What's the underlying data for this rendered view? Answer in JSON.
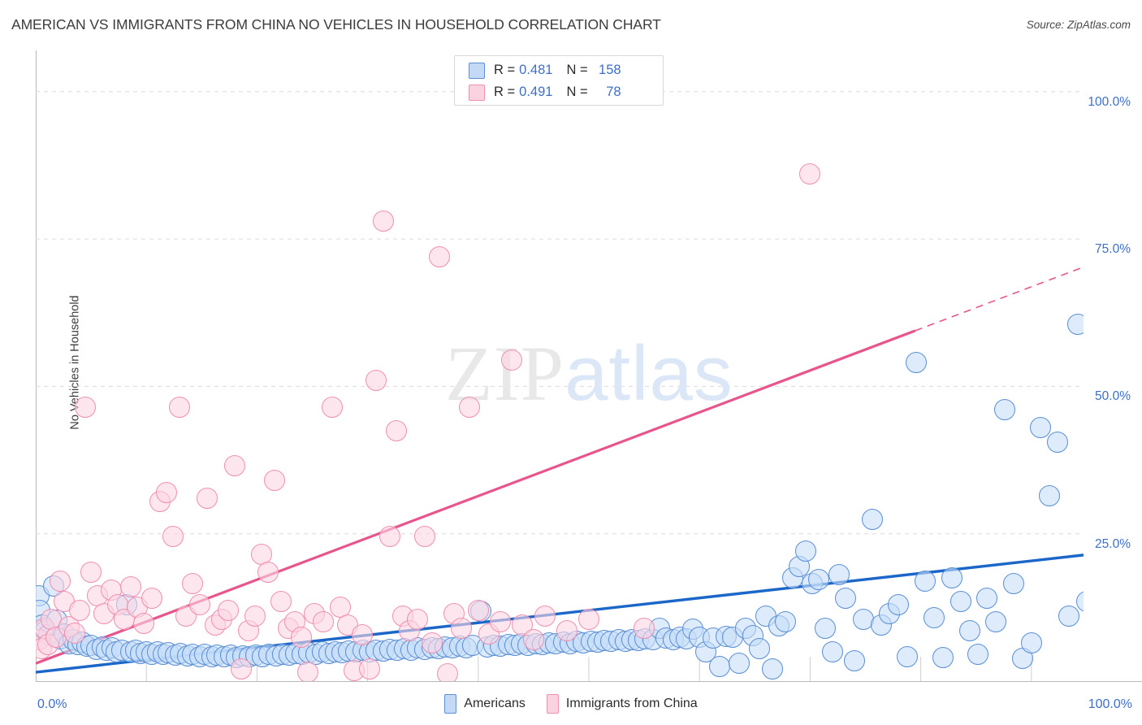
{
  "header": {
    "title": "AMERICAN VS IMMIGRANTS FROM CHINA NO VEHICLES IN HOUSEHOLD CORRELATION CHART",
    "source": "Source: ZipAtlas.com"
  },
  "watermark": {
    "part1": "ZIP",
    "part2": "atlas"
  },
  "stats_legend": {
    "rows": [
      {
        "series": "Americans",
        "r_label": "R = ",
        "r_value": "0.481",
        "n_label": "N = ",
        "n_value": "158",
        "color": "#c3d9f6"
      },
      {
        "series": "Immigrants from China",
        "r_label": "R = ",
        "r_value": "0.491",
        "n_label": "N = ",
        "n_value": "78",
        "color": "#fbd3e0"
      }
    ]
  },
  "series_legend": [
    {
      "label": "Americans",
      "color": "#c3d9f6"
    },
    {
      "label": "Immigrants from China",
      "color": "#fbd3e0"
    }
  ],
  "axes": {
    "y_title": "No Vehicles in Household",
    "y_ticks": [
      "100.0%",
      "75.0%",
      "50.0%",
      "25.0%"
    ],
    "x_min_label": "0.0%",
    "x_max_label": "100.0%"
  },
  "colors": {
    "blue_line": "#1b66c9",
    "pink_line": "#e8548c",
    "blue_fill": "#c6def8",
    "blue_stroke": "#5b8fd4",
    "pink_fill": "#fbd5e2",
    "pink_stroke": "#ef8fb0",
    "tick_text": "#3d6fc4",
    "grid": "#dcdcdc"
  },
  "chart_data": {
    "type": "scatter",
    "title": "AMERICAN VS IMMIGRANTS FROM CHINA NO VEHICLES IN HOUSEHOLD CORRELATION CHART",
    "xlabel": "",
    "ylabel": "No Vehicles in Household",
    "xlim": [
      0,
      100
    ],
    "ylim": [
      0,
      107
    ],
    "x_ticks": [
      0,
      100
    ],
    "y_ticks": [
      25,
      50,
      75,
      100
    ],
    "grid": true,
    "legend_position": "bottom-center",
    "series": [
      {
        "name": "Americans",
        "color": "#c6def8",
        "stroke": "#5b8fd4",
        "R": 0.481,
        "N": 158,
        "trend": {
          "x0": 0,
          "y0": 1.5,
          "x1": 100,
          "y1": 22.5,
          "color": "#1b66c9",
          "style": "solid"
        },
        "points": [
          [
            0.3,
            14.5
          ],
          [
            0.4,
            12.0
          ],
          [
            0.6,
            9.5
          ],
          [
            0.9,
            8.6
          ],
          [
            1.2,
            7.8
          ],
          [
            1.6,
            16.2
          ],
          [
            1.9,
            10.4
          ],
          [
            2.2,
            7.2
          ],
          [
            2.6,
            8.0
          ],
          [
            3.0,
            6.4
          ],
          [
            3.4,
            7.0
          ],
          [
            3.8,
            6.2
          ],
          [
            4.2,
            6.6
          ],
          [
            4.6,
            5.9
          ],
          [
            5.0,
            6.1
          ],
          [
            5.5,
            5.4
          ],
          [
            6.0,
            5.8
          ],
          [
            6.4,
            5.2
          ],
          [
            6.9,
            5.6
          ],
          [
            7.3,
            5.0
          ],
          [
            7.8,
            5.3
          ],
          [
            8.2,
            13.0
          ],
          [
            8.6,
            4.9
          ],
          [
            9.0,
            5.2
          ],
          [
            9.5,
            4.7
          ],
          [
            10.0,
            5.0
          ],
          [
            10.5,
            4.6
          ],
          [
            11.0,
            4.9
          ],
          [
            11.5,
            4.5
          ],
          [
            12.0,
            4.8
          ],
          [
            12.6,
            4.4
          ],
          [
            13.1,
            4.7
          ],
          [
            13.7,
            4.3
          ],
          [
            14.2,
            4.6
          ],
          [
            14.8,
            4.2
          ],
          [
            15.3,
            4.5
          ],
          [
            15.9,
            4.2
          ],
          [
            16.4,
            4.4
          ],
          [
            17.0,
            4.1
          ],
          [
            17.6,
            4.4
          ],
          [
            18.1,
            4.0
          ],
          [
            18.7,
            4.3
          ],
          [
            19.3,
            4.1
          ],
          [
            19.9,
            4.4
          ],
          [
            20.5,
            4.2
          ],
          [
            21.1,
            4.5
          ],
          [
            21.7,
            4.3
          ],
          [
            22.3,
            4.6
          ],
          [
            22.9,
            4.4
          ],
          [
            23.5,
            4.7
          ],
          [
            24.1,
            4.5
          ],
          [
            24.7,
            4.8
          ],
          [
            25.3,
            4.6
          ],
          [
            25.9,
            4.9
          ],
          [
            26.5,
            4.7
          ],
          [
            27.1,
            5.0
          ],
          [
            27.7,
            4.8
          ],
          [
            28.3,
            5.1
          ],
          [
            28.9,
            4.9
          ],
          [
            29.6,
            5.2
          ],
          [
            30.2,
            5.0
          ],
          [
            30.8,
            5.3
          ],
          [
            31.4,
            5.1
          ],
          [
            32.0,
            5.4
          ],
          [
            32.7,
            5.2
          ],
          [
            33.3,
            5.5
          ],
          [
            33.9,
            5.3
          ],
          [
            34.5,
            5.6
          ],
          [
            35.2,
            5.4
          ],
          [
            35.8,
            5.7
          ],
          [
            36.4,
            5.5
          ],
          [
            37.0,
            5.8
          ],
          [
            37.7,
            5.6
          ],
          [
            38.3,
            5.9
          ],
          [
            38.9,
            5.7
          ],
          [
            39.5,
            6.0
          ],
          [
            40.2,
            11.8
          ],
          [
            40.8,
            5.8
          ],
          [
            41.4,
            6.1
          ],
          [
            42.0,
            5.9
          ],
          [
            42.7,
            6.2
          ],
          [
            43.3,
            6.0
          ],
          [
            43.9,
            6.3
          ],
          [
            44.5,
            6.1
          ],
          [
            45.2,
            6.4
          ],
          [
            45.8,
            6.2
          ],
          [
            46.4,
            6.5
          ],
          [
            47.0,
            6.3
          ],
          [
            47.7,
            6.6
          ],
          [
            48.3,
            6.4
          ],
          [
            48.9,
            6.7
          ],
          [
            49.5,
            6.5
          ],
          [
            50.2,
            6.8
          ],
          [
            50.8,
            6.6
          ],
          [
            51.4,
            6.9
          ],
          [
            52.0,
            6.7
          ],
          [
            52.7,
            7.0
          ],
          [
            53.3,
            6.8
          ],
          [
            53.9,
            7.1
          ],
          [
            54.5,
            6.9
          ],
          [
            55.1,
            7.2
          ],
          [
            55.8,
            7.0
          ],
          [
            56.4,
            9.0
          ],
          [
            57.0,
            7.3
          ],
          [
            57.6,
            7.1
          ],
          [
            58.2,
            7.4
          ],
          [
            58.8,
            7.2
          ],
          [
            59.4,
            8.8
          ],
          [
            60.0,
            7.5
          ],
          [
            60.6,
            5.0
          ],
          [
            61.2,
            7.3
          ],
          [
            61.8,
            2.5
          ],
          [
            62.4,
            7.6
          ],
          [
            63.0,
            7.4
          ],
          [
            63.6,
            3.0
          ],
          [
            64.2,
            8.9
          ],
          [
            64.8,
            7.7
          ],
          [
            65.4,
            5.5
          ],
          [
            66.0,
            11.0
          ],
          [
            66.6,
            2.0
          ],
          [
            67.2,
            9.4
          ],
          [
            67.8,
            10.0
          ],
          [
            68.4,
            17.5
          ],
          [
            69.0,
            19.5
          ],
          [
            69.6,
            22.0
          ],
          [
            70.2,
            16.5
          ],
          [
            70.8,
            17.2
          ],
          [
            71.4,
            9.0
          ],
          [
            72.0,
            5.0
          ],
          [
            72.6,
            18.0
          ],
          [
            73.2,
            14.0
          ],
          [
            74.0,
            3.5
          ],
          [
            74.8,
            10.5
          ],
          [
            75.6,
            27.5
          ],
          [
            76.4,
            9.5
          ],
          [
            77.2,
            11.5
          ],
          [
            78.0,
            13.0
          ],
          [
            78.8,
            4.2
          ],
          [
            79.6,
            54.0
          ],
          [
            80.4,
            17.0
          ],
          [
            81.2,
            10.8
          ],
          [
            82.0,
            4.0
          ],
          [
            82.8,
            17.5
          ],
          [
            83.6,
            13.5
          ],
          [
            84.4,
            8.5
          ],
          [
            85.2,
            4.5
          ],
          [
            86.0,
            14.0
          ],
          [
            86.8,
            10.0
          ],
          [
            87.6,
            46.0
          ],
          [
            88.4,
            16.5
          ],
          [
            89.2,
            3.8
          ],
          [
            90.0,
            6.5
          ],
          [
            90.8,
            43.0
          ],
          [
            91.6,
            31.5
          ],
          [
            92.4,
            40.5
          ],
          [
            93.4,
            11.0
          ],
          [
            94.2,
            60.5
          ],
          [
            95.0,
            13.5
          ],
          [
            96.0,
            53.5
          ],
          [
            96.8,
            31.5
          ],
          [
            97.8,
            4.5
          ],
          [
            99.0,
            41.0
          ]
        ]
      },
      {
        "name": "Immigrants from China",
        "color": "#fbd5e2",
        "stroke": "#ef8fb0",
        "R": 0.491,
        "N": 78,
        "trend": {
          "x0": 0,
          "y0": 3.0,
          "x1": 100,
          "y1": 74.0,
          "color": "#e8548c",
          "style": "solid-then-dashed",
          "dash_start_x": 79.5
        },
        "points": [
          [
            0.3,
            7.0
          ],
          [
            0.5,
            5.5
          ],
          [
            0.8,
            9.0
          ],
          [
            1.1,
            6.2
          ],
          [
            1.4,
            10.5
          ],
          [
            1.8,
            7.5
          ],
          [
            2.2,
            17.0
          ],
          [
            2.6,
            13.5
          ],
          [
            3.0,
            9.2
          ],
          [
            3.5,
            8.2
          ],
          [
            4.0,
            12.0
          ],
          [
            4.5,
            46.5
          ],
          [
            5.0,
            18.5
          ],
          [
            5.6,
            14.5
          ],
          [
            6.2,
            11.5
          ],
          [
            6.8,
            15.5
          ],
          [
            7.4,
            13.0
          ],
          [
            8.0,
            10.5
          ],
          [
            8.6,
            16.0
          ],
          [
            9.2,
            12.5
          ],
          [
            9.8,
            9.8
          ],
          [
            10.5,
            14.0
          ],
          [
            11.2,
            30.5
          ],
          [
            11.8,
            32.0
          ],
          [
            12.4,
            24.5
          ],
          [
            13.0,
            46.5
          ],
          [
            13.6,
            11.0
          ],
          [
            14.2,
            16.5
          ],
          [
            14.8,
            13.0
          ],
          [
            15.5,
            31.0
          ],
          [
            16.2,
            9.5
          ],
          [
            16.8,
            10.5
          ],
          [
            17.4,
            12.0
          ],
          [
            18.0,
            36.5
          ],
          [
            18.6,
            2.0
          ],
          [
            19.2,
            8.5
          ],
          [
            19.8,
            11.0
          ],
          [
            20.4,
            21.5
          ],
          [
            21.0,
            18.5
          ],
          [
            21.6,
            34.0
          ],
          [
            22.2,
            13.5
          ],
          [
            22.8,
            9.0
          ],
          [
            23.4,
            10.0
          ],
          [
            24.0,
            7.5
          ],
          [
            24.6,
            1.5
          ],
          [
            25.2,
            11.5
          ],
          [
            26.0,
            10.0
          ],
          [
            26.8,
            46.5
          ],
          [
            27.5,
            12.5
          ],
          [
            28.2,
            9.5
          ],
          [
            28.8,
            1.8
          ],
          [
            29.5,
            7.8
          ],
          [
            30.2,
            2.0
          ],
          [
            30.8,
            51.0
          ],
          [
            31.4,
            78.0
          ],
          [
            32.0,
            24.5
          ],
          [
            32.6,
            42.5
          ],
          [
            33.2,
            11.0
          ],
          [
            33.8,
            8.5
          ],
          [
            34.5,
            10.5
          ],
          [
            35.2,
            24.5
          ],
          [
            35.8,
            6.5
          ],
          [
            36.5,
            72.0
          ],
          [
            37.2,
            1.2
          ],
          [
            37.8,
            11.5
          ],
          [
            38.5,
            9.0
          ],
          [
            39.2,
            46.5
          ],
          [
            40.0,
            12.0
          ],
          [
            41.0,
            8.0
          ],
          [
            42.0,
            10.0
          ],
          [
            43.0,
            54.5
          ],
          [
            44.0,
            9.5
          ],
          [
            45.0,
            7.0
          ],
          [
            46.0,
            11.0
          ],
          [
            48.0,
            8.5
          ],
          [
            50.0,
            10.5
          ],
          [
            55.0,
            9.0
          ],
          [
            70.0,
            86.0
          ]
        ]
      }
    ]
  }
}
